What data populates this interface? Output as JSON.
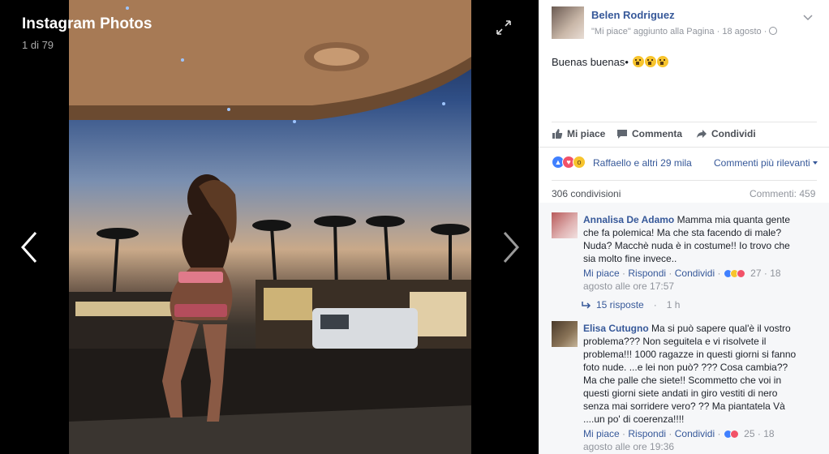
{
  "viewer": {
    "album_title": "Instagram Photos",
    "counter": "1 di 79"
  },
  "post": {
    "author": "Belen Rodriguez",
    "meta_action": "\"Mi piace\" aggiunto alla Pagina",
    "meta_sep": "·",
    "meta_date": "18 agosto",
    "meta_dot": "·",
    "text": "Buenas buenas•"
  },
  "actions": {
    "like": "Mi piace",
    "comment": "Commenta",
    "share": "Condividi"
  },
  "reactions": {
    "summary": "Raffaello e altri 29 mila",
    "sort_label": "Commenti più rilevanti",
    "shares": "306 condivisioni",
    "comments": "Commenti: 459"
  },
  "comments": [
    {
      "author": "Annalisa De Adamo",
      "text": "Mamma mia quanta gente che fa polemica! Ma che sta facendo di male? Nuda? Macchè nuda è in costume!! Io trovo che sia molto fine invece..",
      "like": "Mi piace",
      "reply": "Rispondi",
      "share": "Condividi",
      "reaction_count": "27",
      "sep": "·",
      "date": "18 agosto alle ore 17:57",
      "replies_label": "15 risposte",
      "replies_time": "1 h"
    },
    {
      "author": "Elisa Cutugno",
      "text": "Ma si può sapere qual'è il vostro problema??? Non seguitela e vi risolvete il problema!!! 1000 ragazze in questi giorni si fanno foto nude. ...e lei non può? ??? Cosa cambia?? Ma che palle che siete!! Scommetto che voi in questi giorni siete andati in giro vestiti di nero senza mai sorridere vero? ?? Ma piantatela Và ....un po' di coerenza!!!!",
      "like": "Mi piace",
      "reply": "Rispondi",
      "share": "Condividi",
      "reaction_count": "25",
      "sep": "·",
      "date": "18 agosto alle ore 19:36"
    }
  ],
  "colors": {
    "link": "#365899",
    "muted": "#90949c",
    "like": "#4080ff",
    "love": "#f25268",
    "wow": "#f7c42d"
  }
}
